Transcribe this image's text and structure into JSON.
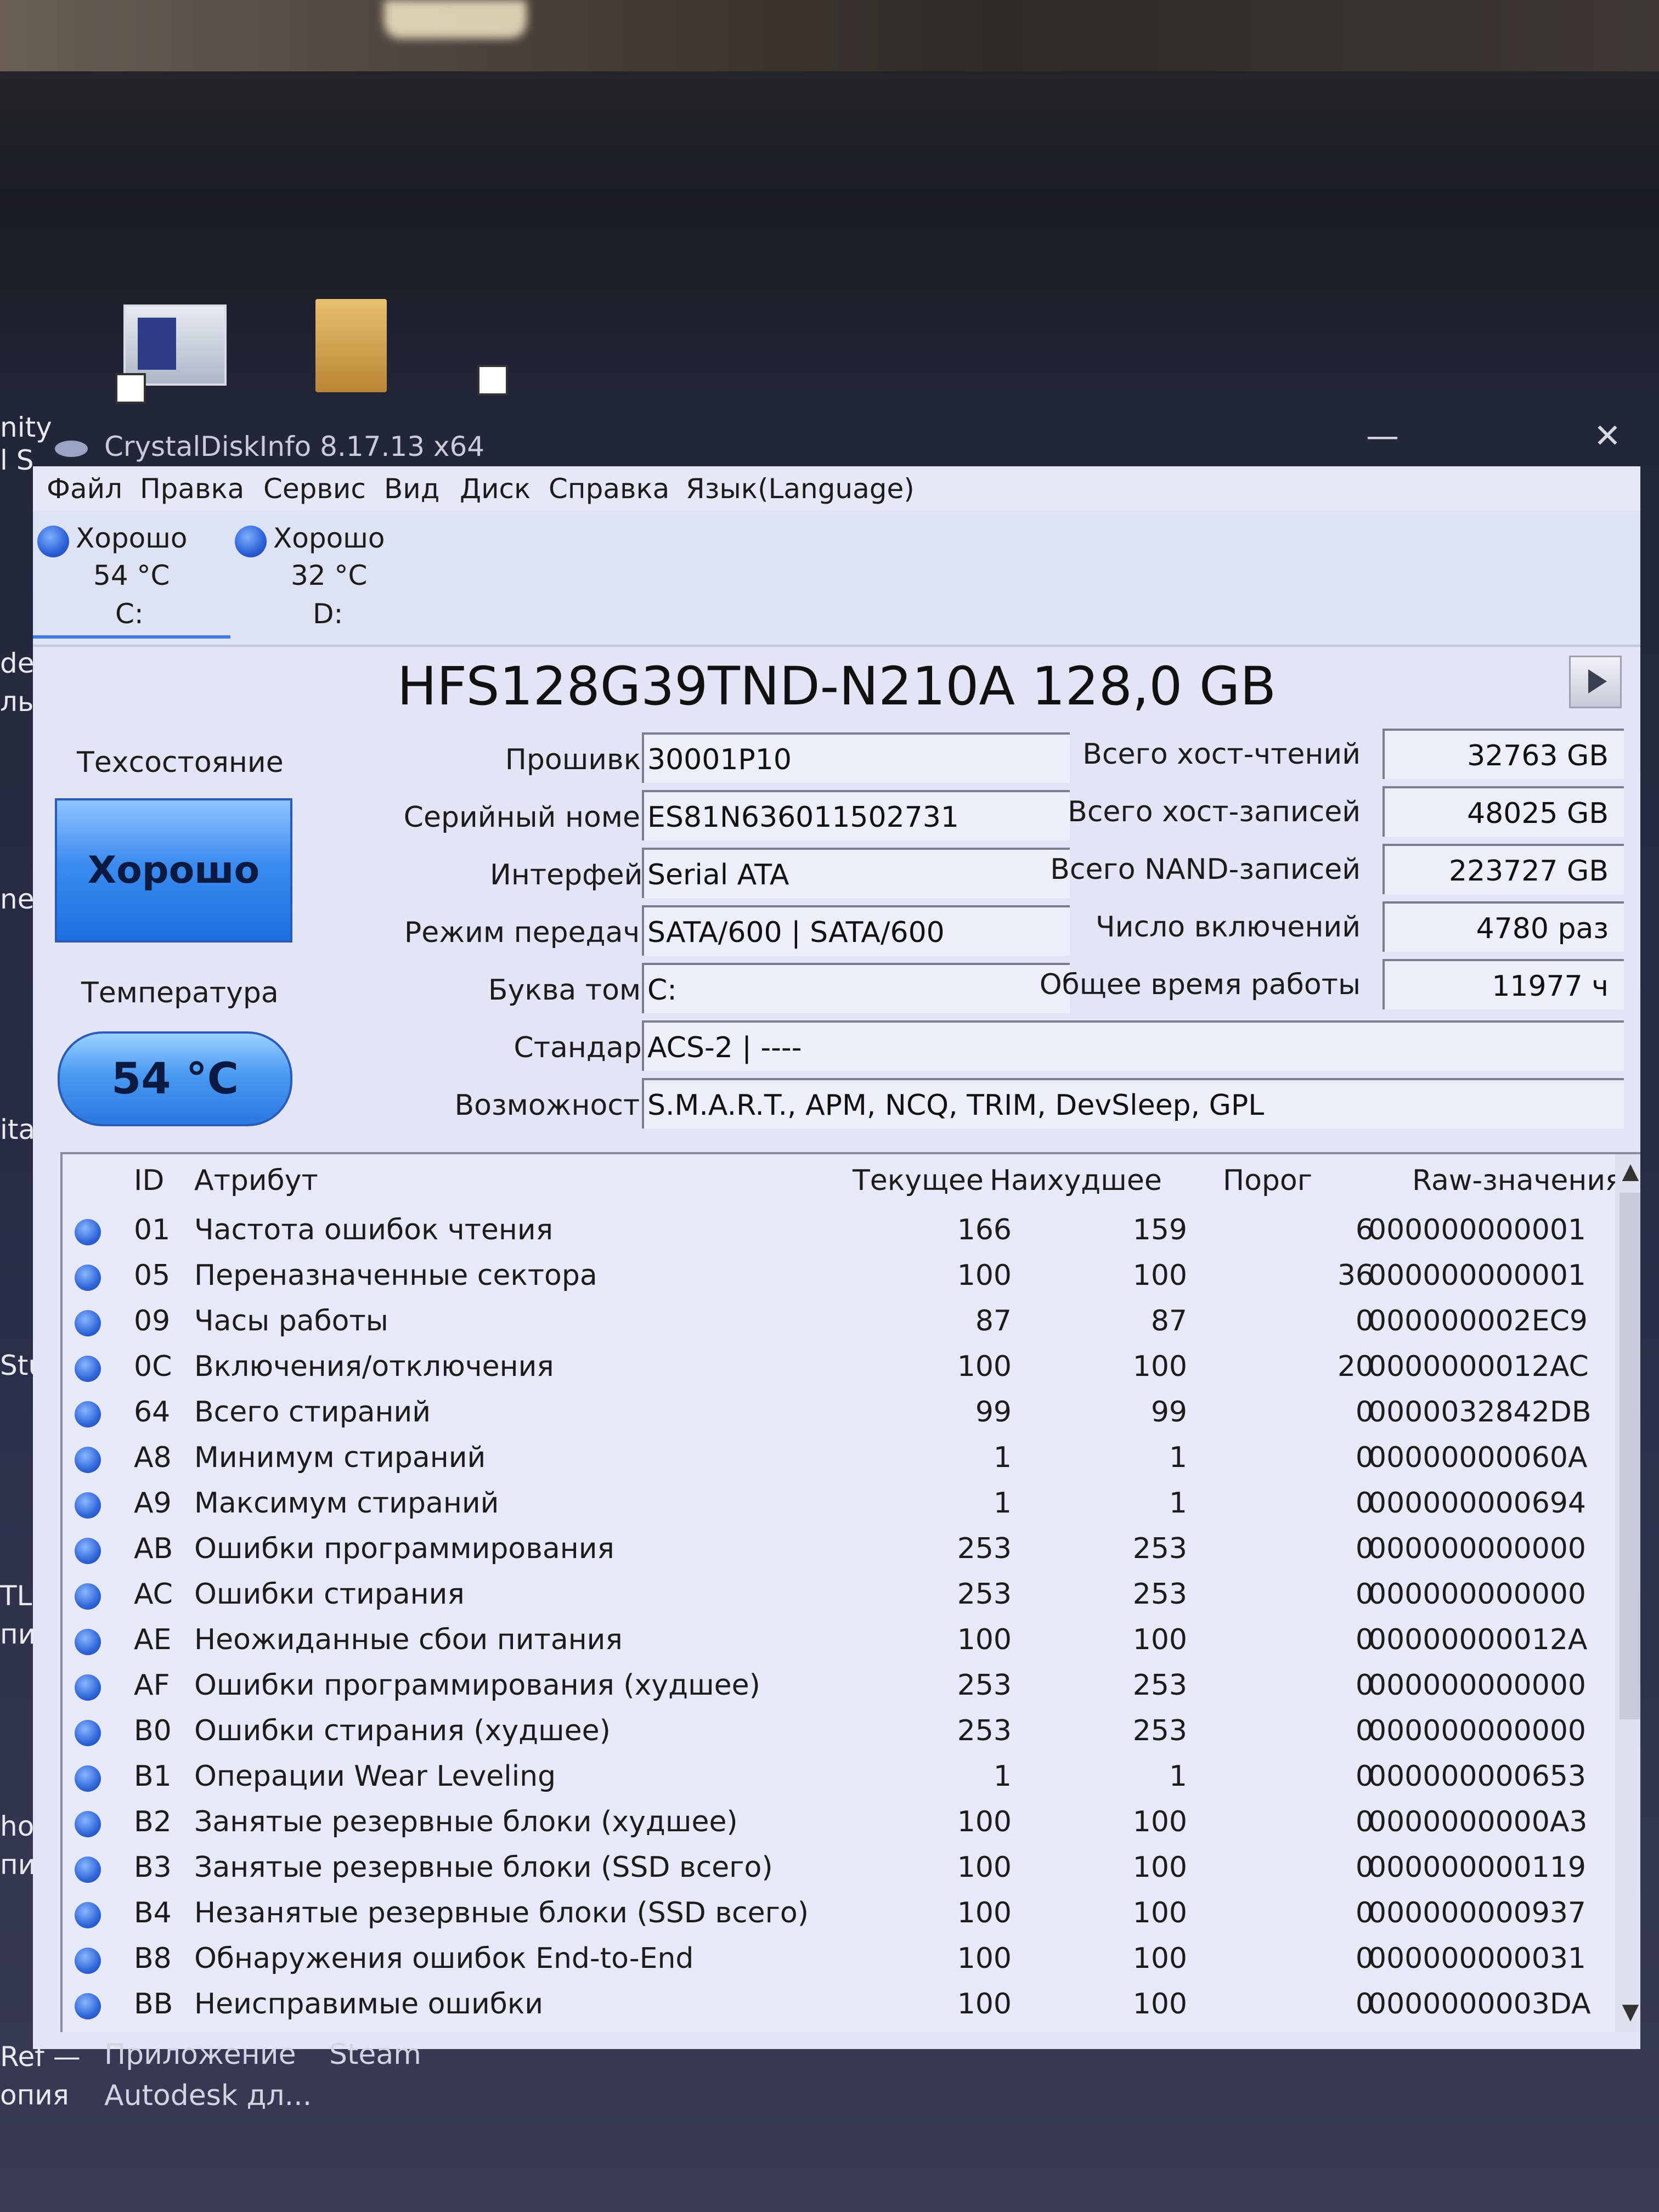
{
  "window": {
    "title": "CrystalDiskInfo 8.17.13 x64",
    "minimize_glyph": "—",
    "close_glyph": "✕"
  },
  "menu": [
    "Файл",
    "Правка",
    "Сервис",
    "Вид",
    "Диск",
    "Справка",
    "Язык(Language)"
  ],
  "disks": [
    {
      "status": "Хорошо",
      "temp": "54 °C",
      "letter": "C:"
    },
    {
      "status": "Хорошо",
      "temp": "32 °C",
      "letter": "D:"
    }
  ],
  "model": "HFS128G39TND-N210A 128,0 GB",
  "health": {
    "label": "Техсостояние",
    "value": "Хорошо"
  },
  "temperature": {
    "label": "Температура",
    "value": "54 °C"
  },
  "info_left": [
    {
      "label": "Прошивка",
      "value": "30001P10"
    },
    {
      "label": "Серийный номер",
      "value": "ES81N636011502731"
    },
    {
      "label": "Интерфейс",
      "value": "Serial ATA"
    },
    {
      "label": "Режим передачи",
      "value": "SATA/600 | SATA/600"
    },
    {
      "label": "Буква тома",
      "value": "C:"
    },
    {
      "label": "Стандарт",
      "value": "ACS-2 | ----"
    },
    {
      "label": "Возможности",
      "value": "S.M.A.R.T., APM, NCQ, TRIM, DevSleep, GPL"
    }
  ],
  "info_right": [
    {
      "label": "Всего хост-чтений",
      "value": "32763 GB"
    },
    {
      "label": "Всего хост-записей",
      "value": "48025 GB"
    },
    {
      "label": "Всего NAND-записей",
      "value": "223727 GB"
    },
    {
      "label": "Число включений",
      "value": "4780 раз"
    },
    {
      "label": "Общее время работы",
      "value": "11977 ч"
    }
  ],
  "table": {
    "headers": {
      "id": "ID",
      "attr": "Атрибут",
      "current": "Текущее",
      "worst": "Наихудшее",
      "threshold": "Порог",
      "raw": "Raw-значения"
    },
    "rows": [
      {
        "id": "01",
        "attr": "Частота ошибок чтения",
        "current": "166",
        "worst": "159",
        "threshold": "6",
        "raw": "000000000001"
      },
      {
        "id": "05",
        "attr": "Переназначенные сектора",
        "current": "100",
        "worst": "100",
        "threshold": "36",
        "raw": "000000000001"
      },
      {
        "id": "09",
        "attr": "Часы работы",
        "current": "87",
        "worst": "87",
        "threshold": "0",
        "raw": "000000002EC9"
      },
      {
        "id": "0C",
        "attr": "Включения/отключения",
        "current": "100",
        "worst": "100",
        "threshold": "20",
        "raw": "0000000012AC"
      },
      {
        "id": "64",
        "attr": "Всего стираний",
        "current": "99",
        "worst": "99",
        "threshold": "0",
        "raw": "0000032842DB"
      },
      {
        "id": "A8",
        "attr": "Минимум стираний",
        "current": "1",
        "worst": "1",
        "threshold": "0",
        "raw": "00000000060A"
      },
      {
        "id": "A9",
        "attr": "Максимум стираний",
        "current": "1",
        "worst": "1",
        "threshold": "0",
        "raw": "000000000694"
      },
      {
        "id": "AB",
        "attr": "Ошибки программирования",
        "current": "253",
        "worst": "253",
        "threshold": "0",
        "raw": "000000000000"
      },
      {
        "id": "AC",
        "attr": "Ошибки стирания",
        "current": "253",
        "worst": "253",
        "threshold": "0",
        "raw": "000000000000"
      },
      {
        "id": "AE",
        "attr": "Неожиданные сбои питания",
        "current": "100",
        "worst": "100",
        "threshold": "0",
        "raw": "00000000012A"
      },
      {
        "id": "AF",
        "attr": "Ошибки программирования (худшее)",
        "current": "253",
        "worst": "253",
        "threshold": "0",
        "raw": "000000000000"
      },
      {
        "id": "B0",
        "attr": "Ошибки стирания (худшее)",
        "current": "253",
        "worst": "253",
        "threshold": "0",
        "raw": "000000000000"
      },
      {
        "id": "B1",
        "attr": "Операции Wear Leveling",
        "current": "1",
        "worst": "1",
        "threshold": "0",
        "raw": "000000000653"
      },
      {
        "id": "B2",
        "attr": "Занятые резервные блоки (худшее)",
        "current": "100",
        "worst": "100",
        "threshold": "0",
        "raw": "0000000000A3"
      },
      {
        "id": "B3",
        "attr": "Занятые резервные блоки (SSD всего)",
        "current": "100",
        "worst": "100",
        "threshold": "0",
        "raw": "000000000119"
      },
      {
        "id": "B4",
        "attr": "Незанятые резервные блоки (SSD всего)",
        "current": "100",
        "worst": "100",
        "threshold": "0",
        "raw": "000000000937"
      },
      {
        "id": "B8",
        "attr": "Обнаружения ошибок End-to-End",
        "current": "100",
        "worst": "100",
        "threshold": "0",
        "raw": "000000000031"
      },
      {
        "id": "BB",
        "attr": "Неисправимые ошибки",
        "current": "100",
        "worst": "100",
        "threshold": "0",
        "raw": "0000000003DA"
      }
    ]
  },
  "desktop": {
    "left_fragments": [
      "nity",
      "l S",
      "de",
      "лы",
      "nes",
      "ita",
      "Stud",
      "TLau",
      "пия",
      "hot",
      "пия",
      "Ref —",
      "опия"
    ],
    "taskbar_labels": [
      "Приложение",
      "Autodesk дл...",
      "Steam"
    ]
  }
}
